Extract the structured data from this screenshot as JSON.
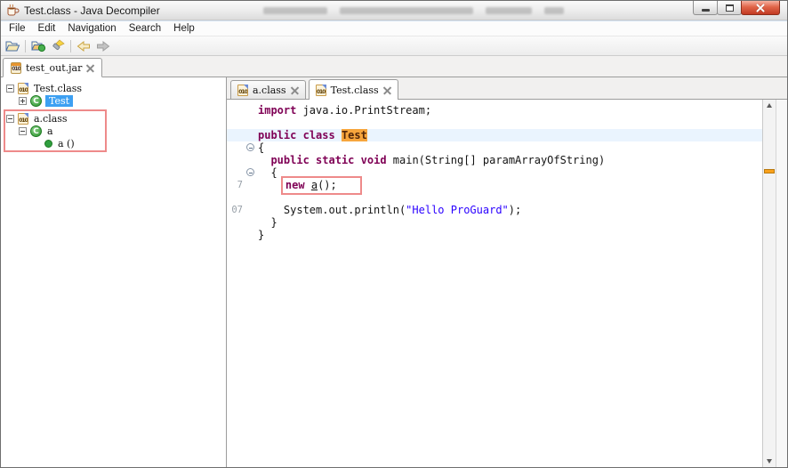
{
  "window": {
    "title": "Test.class - Java Decompiler",
    "controls": [
      "minimize",
      "maximize",
      "close"
    ]
  },
  "menu_bar": {
    "items": [
      "File",
      "Edit",
      "Navigation",
      "Search",
      "Help"
    ]
  },
  "toolbar": {
    "buttons": [
      "open-file",
      "open-type",
      "search",
      "back",
      "forward"
    ]
  },
  "workspace_tabs": [
    {
      "label": "test_out.jar",
      "icon": "jar",
      "active": true
    }
  ],
  "tree": {
    "rows": [
      {
        "label": "Test.class",
        "level": 0,
        "toggle": "minus",
        "icon": "classfile"
      },
      {
        "label": "Test",
        "level": 1,
        "toggle": "plus",
        "icon": "class",
        "selected": true
      },
      {
        "label": "a.class",
        "level": 0,
        "toggle": "minus",
        "icon": "classfile",
        "top_gap": true,
        "annotated": true
      },
      {
        "label": "a",
        "level": 1,
        "toggle": "minus",
        "icon": "class",
        "annotated": true
      },
      {
        "label": "a ()",
        "level": 2,
        "toggle": "none",
        "icon": "method",
        "annotated": true
      }
    ]
  },
  "editor": {
    "tabs": [
      {
        "label": "a.class",
        "icon": "classfile",
        "active": false
      },
      {
        "label": "Test.class",
        "icon": "classfile",
        "active": true
      }
    ],
    "code": {
      "lines": [
        {
          "segs": [
            {
              "t": "import",
              "s": "kw"
            },
            {
              "t": " java.io.PrintStream;",
              "s": "pl"
            }
          ]
        },
        {
          "segs": []
        },
        {
          "current_line": true,
          "segs": [
            {
              "t": "public",
              "s": "kw"
            },
            {
              "t": " ",
              "s": "pl"
            },
            {
              "t": "class",
              "s": "kw"
            },
            {
              "t": " ",
              "s": "pl"
            },
            {
              "t": "Test",
              "s": "occ"
            }
          ]
        },
        {
          "fold": "collapse",
          "segs": [
            {
              "t": "{",
              "s": "pl"
            }
          ]
        },
        {
          "segs": [
            {
              "t": "  ",
              "s": "pl"
            },
            {
              "t": "public",
              "s": "kw"
            },
            {
              "t": " ",
              "s": "pl"
            },
            {
              "t": "static",
              "s": "kw"
            },
            {
              "t": " ",
              "s": "pl"
            },
            {
              "t": "void",
              "s": "kw"
            },
            {
              "t": " main(String[] paramArrayOfString)",
              "s": "pl"
            }
          ]
        },
        {
          "fold": "collapse",
          "segs": [
            {
              "t": "  {",
              "s": "pl"
            }
          ]
        },
        {
          "gutter": "7",
          "box_start": 1,
          "segs": [
            {
              "t": "    ",
              "s": "pl"
            },
            {
              "t": "new",
              "s": "kw"
            },
            {
              "t": " ",
              "s": "pl"
            },
            {
              "t": "a",
              "s": "link"
            },
            {
              "t": "();",
              "s": "pl"
            }
          ]
        },
        {
          "segs": []
        },
        {
          "gutter": "07",
          "segs": [
            {
              "t": "    System.out.println(",
              "s": "pl"
            },
            {
              "t": "\"Hello ProGuard\"",
              "s": "str"
            },
            {
              "t": ");",
              "s": "pl"
            }
          ]
        },
        {
          "segs": [
            {
              "t": "  }",
              "s": "pl"
            }
          ]
        },
        {
          "segs": [
            {
              "t": "}",
              "s": "pl"
            }
          ]
        }
      ]
    }
  },
  "colors": {
    "keyword": "#7f0055",
    "string": "#2a00ff",
    "occurrence_bg": "#f7a63d",
    "current_line_bg": "#eaf4fe",
    "tree_selection_bg": "#3da0f2",
    "annotation_red": "#ee8a8a",
    "overview_marker_orange": "#f9a11b",
    "close_button_red": "#c23a22"
  }
}
